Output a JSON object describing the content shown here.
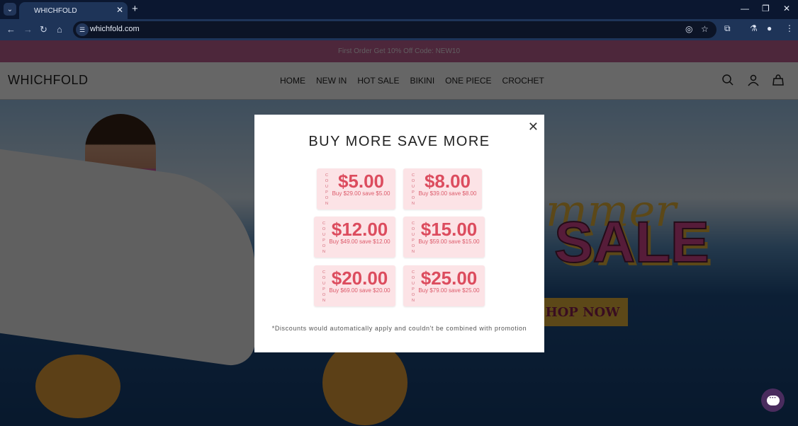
{
  "browser": {
    "tab_title": "WHICHFOLD",
    "url": "whichfold.com",
    "icons": {
      "tab_search": "chevron-down-icon",
      "tab_close": "close-icon",
      "new_tab": "plus-icon",
      "back": "arrow-left-icon",
      "forward": "arrow-right-icon",
      "reload": "reload-icon",
      "home": "home-icon",
      "site_info": "tune-icon",
      "eye_off": "eye-off-icon",
      "bookmark": "star-icon",
      "extensions": "puzzle-icon",
      "labs": "flask-icon",
      "profile": "profile-icon",
      "menu": "kebab-menu-icon"
    },
    "glyphs": {
      "chevron": "⌄",
      "close": "✕",
      "plus": "+",
      "minimize": "—",
      "restore": "❐",
      "back": "←",
      "forward": "→",
      "reload": "↻",
      "home": "⌂",
      "tune": "☰",
      "eye_off": "◎",
      "star": "☆",
      "puzzle": "⧉",
      "flask": "⚗",
      "profile": "●",
      "kebab": "⋮"
    }
  },
  "site": {
    "announcement": "First Order Get 10% Off Code:  NEW10",
    "logo": "WHICHFOLD",
    "nav": [
      {
        "label": "HOME"
      },
      {
        "label": "NEW IN"
      },
      {
        "label": "HOT SALE"
      },
      {
        "label": "BIKINI"
      },
      {
        "label": "ONE PIECE"
      },
      {
        "label": "CROCHET"
      }
    ],
    "header_icons": [
      "search-icon",
      "account-icon",
      "shopping-bag-icon"
    ],
    "hero": {
      "script_text": "mmer",
      "headline": "SALE",
      "cta": "HOP NOW"
    },
    "chat_glyph": "···"
  },
  "modal": {
    "title": "BUY MORE SAVE MORE",
    "close_glyph": "✕",
    "coupon_side_label": "COUPON",
    "coupons": [
      {
        "amount": "$5.00",
        "condition": "Buy $29.00 save $5.00"
      },
      {
        "amount": "$8.00",
        "condition": "Buy $39.00 save $8.00"
      },
      {
        "amount": "$12.00",
        "condition": "Buy $49.00 save $12.00"
      },
      {
        "amount": "$15.00",
        "condition": "Buy $59.00 save $15.00"
      },
      {
        "amount": "$20.00",
        "condition": "Buy $69.00 save $20.00"
      },
      {
        "amount": "$25.00",
        "condition": "Buy $79.00 save $25.00"
      }
    ],
    "disclaimer": "*Discounts would automatically apply and couldn't be combined with promotion"
  },
  "colors": {
    "announcement_bg": "#c06395",
    "coupon_bg": "#fce3e6",
    "coupon_text": "#dc4c5e",
    "browser_chrome": "#1e3458"
  }
}
